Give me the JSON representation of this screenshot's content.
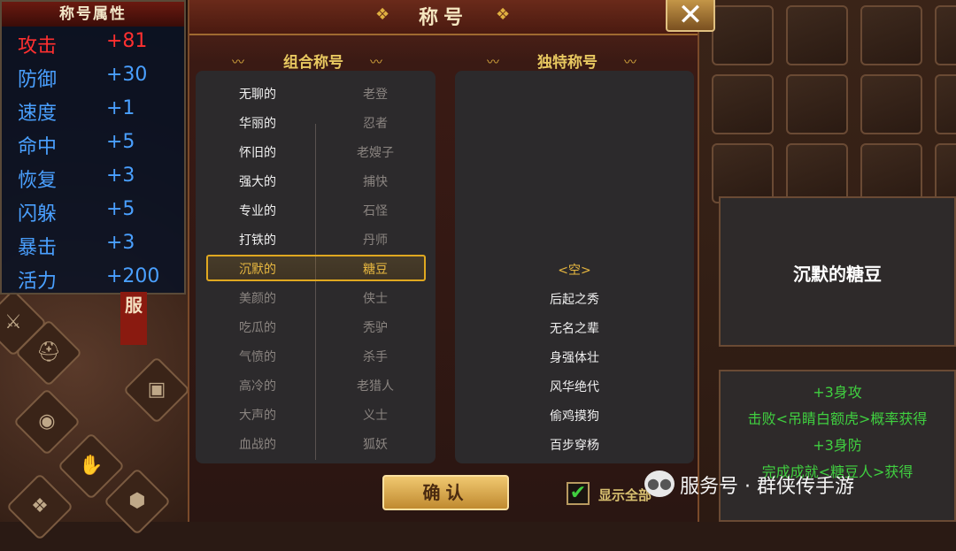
{
  "attributes": {
    "title": "称号属性",
    "rows": [
      {
        "name": "攻击",
        "value": "+81"
      },
      {
        "name": "防御",
        "value": "+30"
      },
      {
        "name": "速度",
        "value": "+1"
      },
      {
        "name": "命中",
        "value": "+5"
      },
      {
        "name": "恢复",
        "value": "+3"
      },
      {
        "name": "闪躲",
        "value": "+5"
      },
      {
        "name": "暴击",
        "value": "+3"
      },
      {
        "name": "活力",
        "value": "+200"
      }
    ]
  },
  "side_tag": "服",
  "dialog": {
    "title": "称号",
    "close_label": "✕",
    "combo_title": "组合称号",
    "unique_title": "独特称号",
    "combo_left": [
      "无聊的",
      "华丽的",
      "怀旧的",
      "强大的",
      "专业的",
      "打铁的",
      "沉默的",
      "美颜的",
      "吃瓜的",
      "气愤的",
      "高冷的",
      "大声的",
      "血战的"
    ],
    "combo_right": [
      "老登",
      "忍者",
      "老嫂子",
      "捕快",
      "石怪",
      "丹师",
      "糖豆",
      "侠士",
      "秃驴",
      "杀手",
      "老猎人",
      "义士",
      "狐妖"
    ],
    "unique_items": [
      "<空>",
      "后起之秀",
      "无名之辈",
      "身强体壮",
      "风华绝代",
      "偷鸡摸狗",
      "百步穿杨"
    ],
    "confirm_label": "确认",
    "show_all_label": "显示全部",
    "show_all_checked": true
  },
  "info": {
    "selected_name": "沉默的糖豆",
    "desc_lines": [
      "+3身攻",
      "击败<吊睛白额虎>概率获得",
      "+3身防",
      "完成成就<糖豆人>获得"
    ]
  },
  "watermark": {
    "text": "服务号 · 群侠传手游"
  },
  "colors": {
    "attack_red": "#ff3030",
    "attr_blue": "#4aa0ff",
    "highlight_gold": "#e0a820",
    "desc_green": "#40d040"
  }
}
